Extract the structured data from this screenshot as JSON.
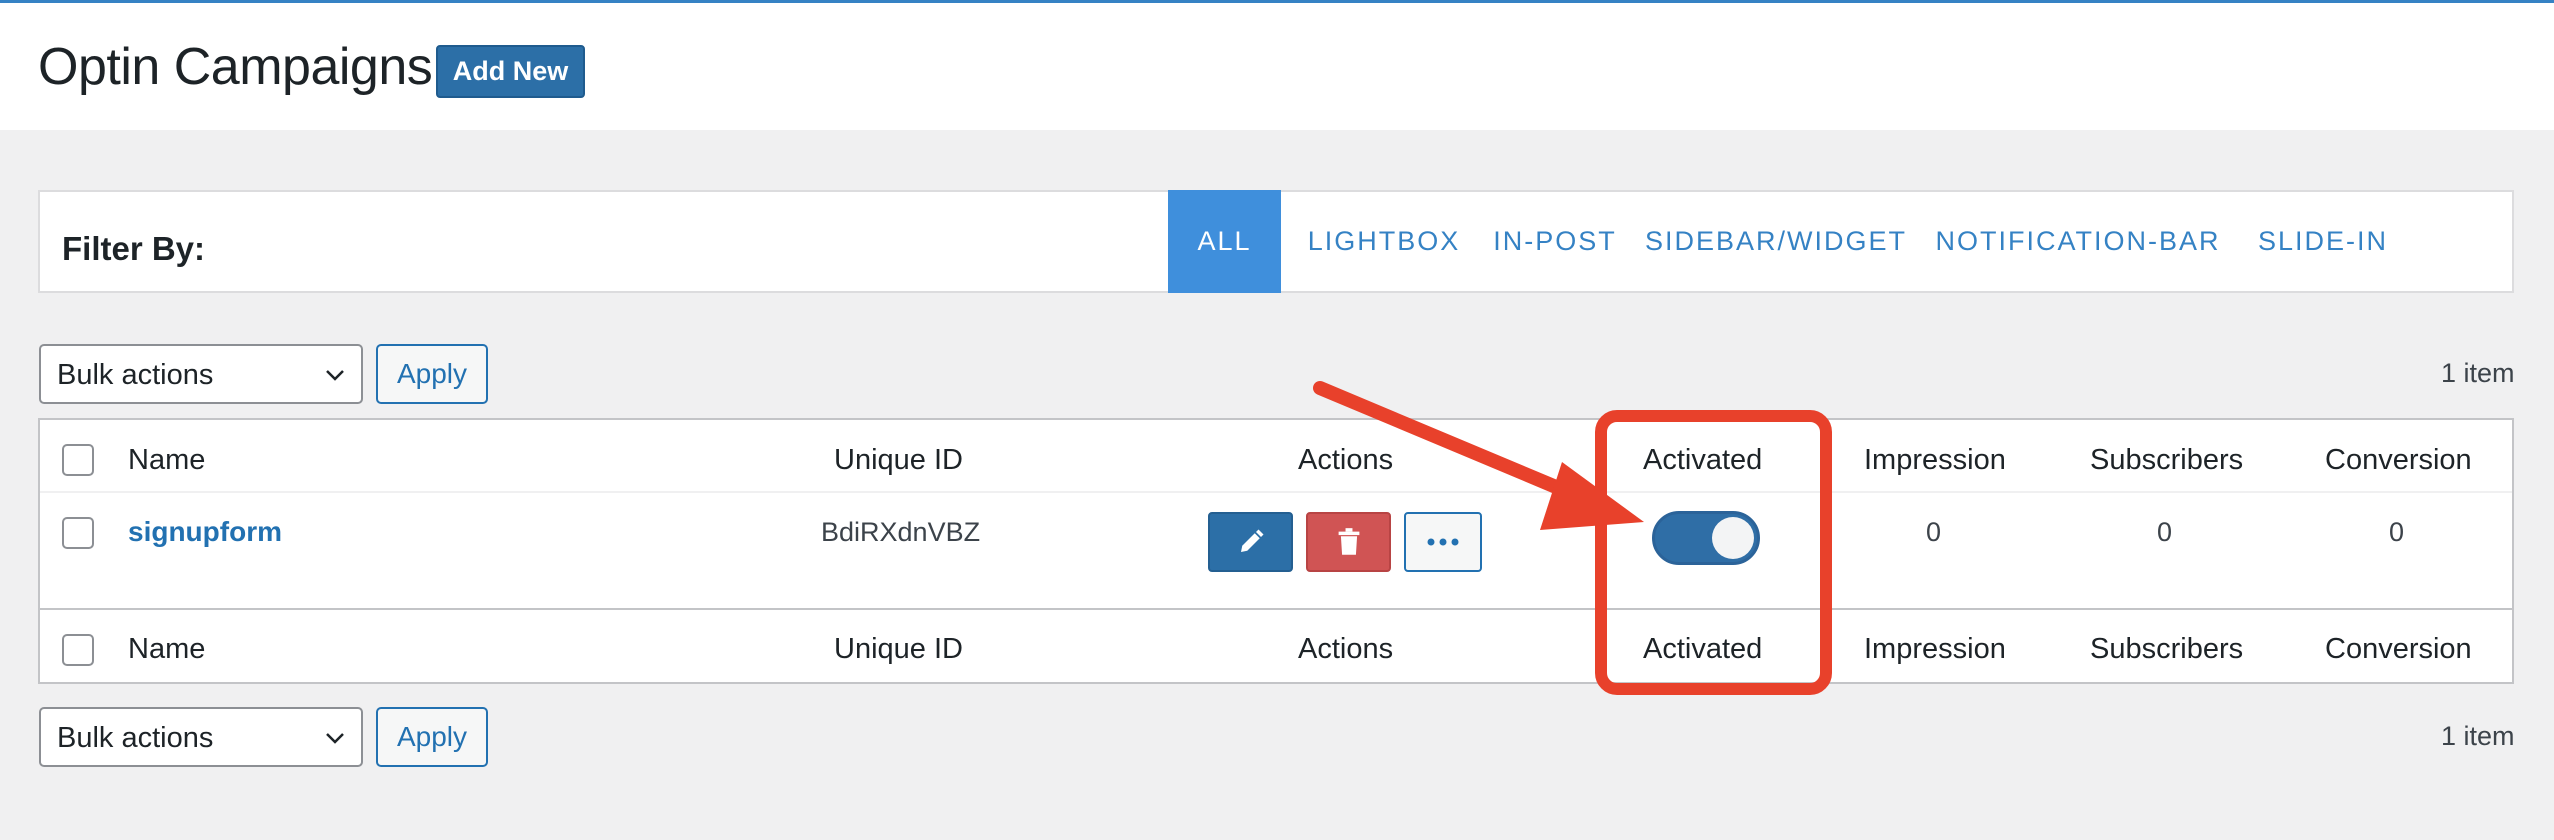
{
  "header": {
    "title": "Optin Campaigns",
    "add_new_label": "Add New"
  },
  "filter": {
    "label": "Filter By:",
    "tabs": [
      {
        "label": "ALL",
        "active": true
      },
      {
        "label": "LIGHTBOX",
        "active": false
      },
      {
        "label": "IN-POST",
        "active": false
      },
      {
        "label": "SIDEBAR/WIDGET",
        "active": false
      },
      {
        "label": "NOTIFICATION-BAR",
        "active": false
      },
      {
        "label": "SLIDE-IN",
        "active": false
      }
    ]
  },
  "bulk_top": {
    "select_value": "Bulk actions",
    "apply_label": "Apply",
    "count": "1 item"
  },
  "bulk_bottom": {
    "select_value": "Bulk actions",
    "apply_label": "Apply",
    "count": "1 item"
  },
  "table": {
    "columns": [
      "Name",
      "Unique ID",
      "Actions",
      "Activated",
      "Impression",
      "Subscribers",
      "Conversion"
    ],
    "rows": [
      {
        "name": "signupform",
        "unique_id": "BdiRXdnVBZ",
        "activated": true,
        "impression": "0",
        "subscribers": "0",
        "conversion": "0"
      }
    ]
  },
  "colors": {
    "accent": "#2271b1",
    "active_tab": "#3f8fdc",
    "delete": "#d05454",
    "annotation": "#e8412b"
  },
  "icons": {
    "edit": "pencil-icon",
    "delete": "trash-icon",
    "more": "ellipsis-icon",
    "dropdown": "chevron-down-icon"
  }
}
